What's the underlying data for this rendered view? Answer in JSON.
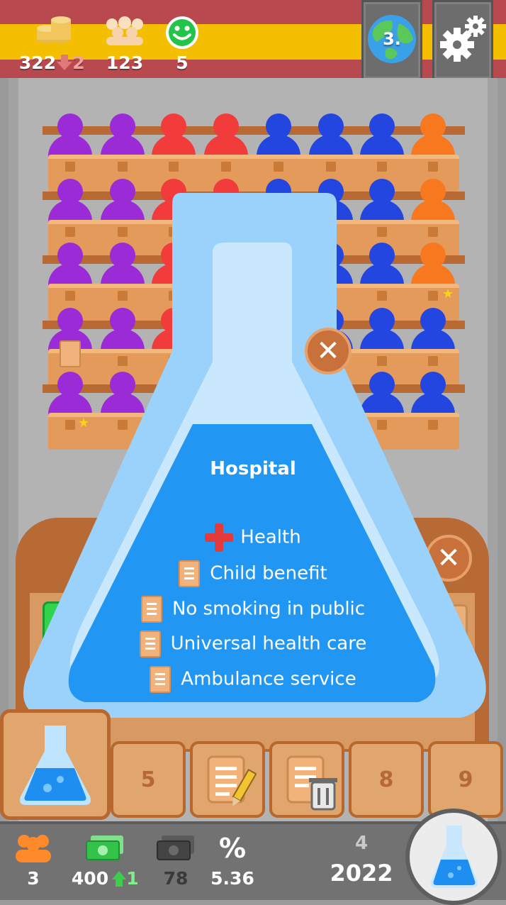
{
  "top_bar": {
    "coins_value": "322",
    "coins_change": "2",
    "population_value": "123",
    "happiness_value": "5",
    "world_rank": "3."
  },
  "dialog": {
    "title": "Hospital",
    "effects": [
      {
        "icon": "health-cross-icon",
        "label": "Health"
      },
      {
        "icon": "document-icon",
        "label": "Child benefit"
      },
      {
        "icon": "document-icon",
        "label": "No smoking in public"
      },
      {
        "icon": "document-icon",
        "label": "Universal health care"
      },
      {
        "icon": "document-icon",
        "label": "Ambulance service"
      }
    ]
  },
  "toolbar": {
    "slot_5": "5",
    "slot_8": "8",
    "slot_9": "9"
  },
  "bottom_bar": {
    "members": "3",
    "income": "400",
    "income_change": "1",
    "expenses": "78",
    "percent_symbol": "%",
    "rate": "5.36",
    "quarter": "4",
    "year": "2022"
  },
  "colors": {
    "purple_party": "#9b2bd6",
    "red_party": "#f23b3b",
    "blue_party": "#2346e0",
    "orange_party": "#f7781e",
    "flask_liquid": "#2196f3",
    "flask_glass": "#9ad2fb"
  }
}
